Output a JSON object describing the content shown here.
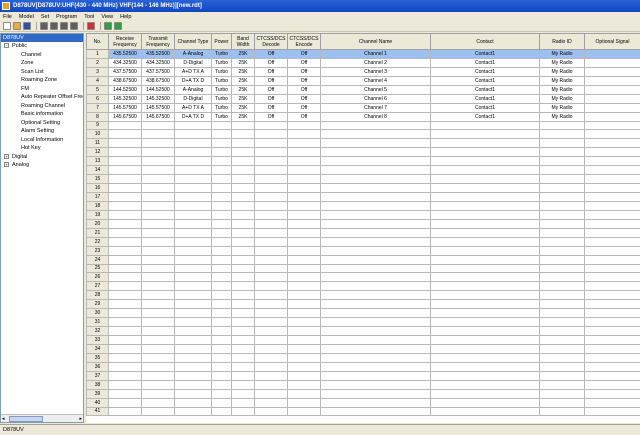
{
  "window": {
    "title": "D878UV[D878UV:UHF(430 - 440 MHz) VHF(144 - 146 MHz)][new.rdt]"
  },
  "menu": [
    "File",
    "Model",
    "Set",
    "Program",
    "Tool",
    "View",
    "Help"
  ],
  "toolbar": {
    "buttons": [
      {
        "icon": "new-icon",
        "color": "#ffffff"
      },
      {
        "icon": "open-icon",
        "color": "#e0b040"
      },
      {
        "icon": "save-icon",
        "color": "#3050a0"
      },
      {
        "icon": "read-radio-icon",
        "color": "#606060"
      },
      {
        "icon": "write-radio-icon",
        "color": "#606060"
      },
      {
        "icon": "read-all-icon",
        "color": "#606060"
      },
      {
        "icon": "write-all-icon",
        "color": "#606060"
      },
      {
        "icon": "about-icon",
        "color": "#d03030"
      },
      {
        "icon": "back-icon",
        "color": "#30a040"
      },
      {
        "icon": "forward-icon",
        "color": "#30a040"
      }
    ]
  },
  "tree": {
    "root": "D878UV",
    "public_label": "Public",
    "public_children": [
      "Channel",
      "Zone",
      "Scan List",
      "Roaming Zone",
      "FM",
      "Auto Repeater Offset Frequencies",
      "Roaming Channel",
      "Basic information",
      "Optional Setting",
      "Alarm Setting",
      "Local Information",
      "Hot Key"
    ],
    "digital_label": "Digital",
    "analog_label": "Analog"
  },
  "grid": {
    "columns": [
      "No.",
      "Receive Frequency",
      "Transmit Frequency",
      "Channel Type",
      "Power",
      "Band Width",
      "CTCSS/DCS Decode",
      "CTCSS/DCS Encode",
      "Channel Name",
      "Contact",
      "Radio ID",
      "Optional Signal"
    ],
    "rows": [
      [
        "1",
        "435.52500",
        "435.52500",
        "A-Analog",
        "Turbo",
        "25K",
        "Off",
        "Off",
        "Channel 1",
        "Contact1",
        "My Radio",
        ""
      ],
      [
        "2",
        "434.32500",
        "434.32500",
        "D-Digital",
        "Turbo",
        "25K",
        "Off",
        "Off",
        "Channel 2",
        "Contact1",
        "My Radio",
        ""
      ],
      [
        "3",
        "437.57500",
        "437.57500",
        "A+D TX A",
        "Turbo",
        "25K",
        "Off",
        "Off",
        "Channel 3",
        "Contact1",
        "My Radio",
        ""
      ],
      [
        "4",
        "438.67500",
        "438.67500",
        "D+A TX D",
        "Turbo",
        "25K",
        "Off",
        "Off",
        "Channel 4",
        "Contact1",
        "My Radio",
        ""
      ],
      [
        "5",
        "144.52500",
        "144.52500",
        "A-Analog",
        "Turbo",
        "25K",
        "Off",
        "Off",
        "Channel 5",
        "Contact1",
        "My Radio",
        ""
      ],
      [
        "6",
        "145.32500",
        "145.32500",
        "D-Digital",
        "Turbo",
        "25K",
        "Off",
        "Off",
        "Channel 6",
        "Contact1",
        "My Radio",
        ""
      ],
      [
        "7",
        "145.57500",
        "145.57500",
        "A+D TX A",
        "Turbo",
        "25K",
        "Off",
        "Off",
        "Channel 7",
        "Contact1",
        "My Radio",
        ""
      ],
      [
        "8",
        "145.67500",
        "145.67500",
        "D+A TX D",
        "Turbo",
        "25K",
        "Off",
        "Off",
        "Channel 8",
        "Contact1",
        "My Radio",
        ""
      ]
    ],
    "empty_rows": [
      "9",
      "10",
      "11",
      "12",
      "13",
      "14",
      "15",
      "16",
      "17",
      "18",
      "19",
      "20",
      "21",
      "22",
      "23",
      "24",
      "25",
      "26",
      "27",
      "28",
      "29",
      "30",
      "31",
      "32",
      "33",
      "34",
      "35",
      "36",
      "37",
      "38",
      "39",
      "40",
      "41"
    ],
    "selected_row": 0,
    "selection_color": "#9cc0f0"
  },
  "status": {
    "text": "D878UV"
  }
}
